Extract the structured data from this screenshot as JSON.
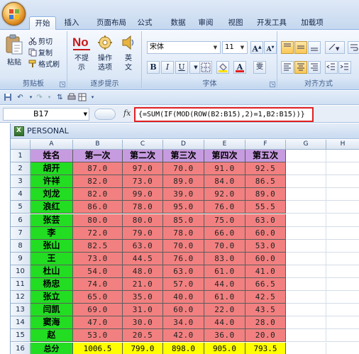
{
  "ribbon_tabs": [
    "开始",
    "插入",
    "页面布局",
    "公式",
    "数据",
    "审阅",
    "视图",
    "开发工具",
    "加载项"
  ],
  "active_tab": "开始",
  "clipboard": {
    "paste_label_1": "粘贴",
    "cut_label": "剪切",
    "copy_label": "复制",
    "format_painter_label": "格式刷",
    "group_label": "剪贴板"
  },
  "prompt_group": {
    "no_icon_text": "No",
    "no_prompt_label_1": "不提",
    "no_prompt_label_2": "示",
    "options_label_1": "操作",
    "options_label_2": "选项",
    "english_label_1": "英",
    "english_label_2": "文",
    "group_label": "逐步提示"
  },
  "font_group": {
    "font_name": "宋体",
    "font_size": "11",
    "grow_label": "A",
    "shrink_label": "A",
    "bold_label": "B",
    "italic_label": "I",
    "underline_label": "U",
    "font_color_label": "A",
    "phonetic_label": "雯",
    "group_label": "字体",
    "accent_font_color": "#e02020",
    "accent_fill_color": "#ffe000"
  },
  "align_group": {
    "group_label": "对齐方式"
  },
  "formula_bar": {
    "name_box": "B17",
    "fx_label": "fx",
    "formula": "{=SUM(IF(MOD(ROW(B2:B15),2)=1,B2:B15))}",
    "highlight_color": "#e02020"
  },
  "workbook": {
    "title": "PERSONAL"
  },
  "sheet": {
    "column_headers": [
      "A",
      "B",
      "C",
      "D",
      "E",
      "F",
      "G",
      "H"
    ],
    "row_numbers": [
      "1",
      "2",
      "3",
      "4",
      "5",
      "6",
      "7",
      "8",
      "9",
      "10",
      "11",
      "12",
      "13",
      "14",
      "15",
      "16"
    ],
    "header_row": [
      "姓名",
      "第一次",
      "第二次",
      "第三次",
      "第四次",
      "第五次"
    ],
    "rows": [
      {
        "name": "胡开",
        "scores": [
          "87.0",
          "97.0",
          "70.0",
          "91.0",
          "92.5"
        ]
      },
      {
        "name": "许祥",
        "scores": [
          "82.0",
          "73.0",
          "89.0",
          "84.0",
          "86.5"
        ]
      },
      {
        "name": "刘龙",
        "scores": [
          "82.0",
          "99.0",
          "39.0",
          "92.0",
          "89.0"
        ]
      },
      {
        "name": "浪红",
        "scores": [
          "86.0",
          "78.0",
          "95.0",
          "76.0",
          "55.5"
        ]
      },
      {
        "name": "张芸",
        "scores": [
          "80.0",
          "80.0",
          "85.0",
          "75.0",
          "63.0"
        ]
      },
      {
        "name": "李",
        "scores": [
          "72.0",
          "79.0",
          "78.0",
          "66.0",
          "60.0"
        ]
      },
      {
        "name": "张山",
        "scores": [
          "82.5",
          "63.0",
          "70.0",
          "70.0",
          "53.0"
        ]
      },
      {
        "name": "王",
        "scores": [
          "73.0",
          "44.5",
          "76.0",
          "83.0",
          "60.0"
        ]
      },
      {
        "name": "杜山",
        "scores": [
          "54.0",
          "48.0",
          "63.0",
          "61.0",
          "41.0"
        ]
      },
      {
        "name": "杨忠",
        "scores": [
          "74.0",
          "21.0",
          "57.0",
          "44.0",
          "66.5"
        ]
      },
      {
        "name": "张立",
        "scores": [
          "65.0",
          "35.0",
          "40.0",
          "61.0",
          "42.5"
        ]
      },
      {
        "name": "闫凯",
        "scores": [
          "69.0",
          "31.0",
          "60.0",
          "22.0",
          "43.5"
        ]
      },
      {
        "name": "窦海",
        "scores": [
          "47.0",
          "30.0",
          "34.0",
          "44.0",
          "28.0"
        ]
      },
      {
        "name": "赵",
        "scores": [
          "53.0",
          "20.5",
          "42.0",
          "36.0",
          "20.0"
        ]
      }
    ],
    "total_label": "总分",
    "totals": [
      "1006.5",
      "799.0",
      "898.0",
      "905.0",
      "793.5"
    ],
    "colors": {
      "header_fill": "#c79be0",
      "name_fill": "#22dd22",
      "score_fill": "#f28080",
      "total_fill": "#ffff00"
    }
  }
}
